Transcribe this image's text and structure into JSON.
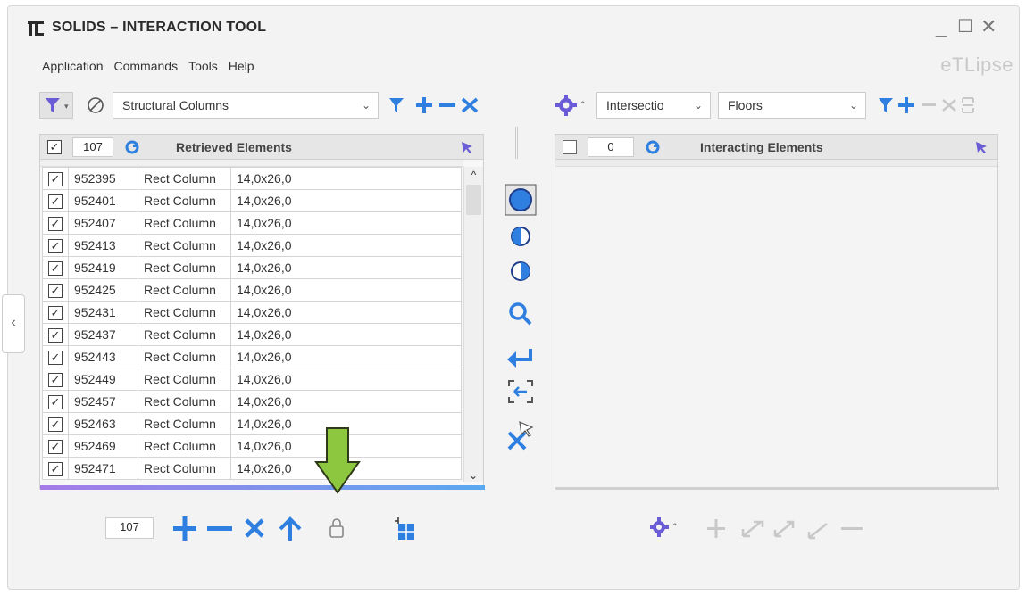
{
  "window": {
    "title": "SOLIDS – INTERACTION TOOL",
    "brand": "eTLipse"
  },
  "menu": [
    "Application",
    "Commands",
    "Tools",
    "Help"
  ],
  "left": {
    "category_dropdown": "Structural Columns",
    "header_count": "107",
    "header_title": "Retrieved Elements",
    "rows": [
      {
        "id": "952395",
        "type": "Rect Column",
        "size": "14,0x26,0"
      },
      {
        "id": "952401",
        "type": "Rect Column",
        "size": "14,0x26,0"
      },
      {
        "id": "952407",
        "type": "Rect Column",
        "size": "14,0x26,0"
      },
      {
        "id": "952413",
        "type": "Rect Column",
        "size": "14,0x26,0"
      },
      {
        "id": "952419",
        "type": "Rect Column",
        "size": "14,0x26,0"
      },
      {
        "id": "952425",
        "type": "Rect Column",
        "size": "14,0x26,0"
      },
      {
        "id": "952431",
        "type": "Rect Column",
        "size": "14,0x26,0"
      },
      {
        "id": "952437",
        "type": "Rect Column",
        "size": "14,0x26,0"
      },
      {
        "id": "952443",
        "type": "Rect Column",
        "size": "14,0x26,0"
      },
      {
        "id": "952449",
        "type": "Rect Column",
        "size": "14,0x26,0"
      },
      {
        "id": "952457",
        "type": "Rect Column",
        "size": "14,0x26,0"
      },
      {
        "id": "952463",
        "type": "Rect Column",
        "size": "14,0x26,0"
      },
      {
        "id": "952469",
        "type": "Rect Column",
        "size": "14,0x26,0"
      },
      {
        "id": "952471",
        "type": "Rect Column",
        "size": "14,0x26,0"
      }
    ],
    "footer_count": "107"
  },
  "right": {
    "mode_dropdown": "Intersectio",
    "category_dropdown": "Floors",
    "header_count": "0",
    "header_title": "Interacting Elements"
  },
  "colors": {
    "accent_blue": "#2f7fe0",
    "icon_purple": "#5b57d6",
    "highlight_green": "#8dc63f"
  }
}
